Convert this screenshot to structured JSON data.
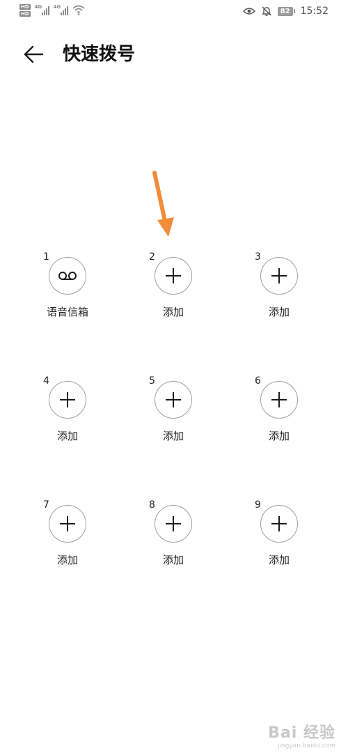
{
  "status_bar": {
    "hd_label": "HD",
    "net_label": "4G",
    "battery": "82",
    "time": "15:52",
    "icons": [
      "hd-icon",
      "signal-icon",
      "wifi-icon",
      "eye-icon",
      "bell-off-icon",
      "battery-icon"
    ]
  },
  "header": {
    "title": "快速拨号",
    "back_icon": "arrow-left-icon"
  },
  "slots": [
    {
      "number": "1",
      "label": "语音信箱",
      "icon": "voicemail-icon"
    },
    {
      "number": "2",
      "label": "添加",
      "icon": "plus-icon"
    },
    {
      "number": "3",
      "label": "添加",
      "icon": "plus-icon"
    },
    {
      "number": "4",
      "label": "添加",
      "icon": "plus-icon"
    },
    {
      "number": "5",
      "label": "添加",
      "icon": "plus-icon"
    },
    {
      "number": "6",
      "label": "添加",
      "icon": "plus-icon"
    },
    {
      "number": "7",
      "label": "添加",
      "icon": "plus-icon"
    },
    {
      "number": "8",
      "label": "添加",
      "icon": "plus-icon"
    },
    {
      "number": "9",
      "label": "添加",
      "icon": "plus-icon"
    }
  ],
  "colors": {
    "annotation_arrow": "#f28c3a",
    "circle_border": "#9e9e9e",
    "text": "#222222"
  },
  "watermark": {
    "logo": "Bai 经验",
    "url": "jingyan.baidu.com"
  }
}
